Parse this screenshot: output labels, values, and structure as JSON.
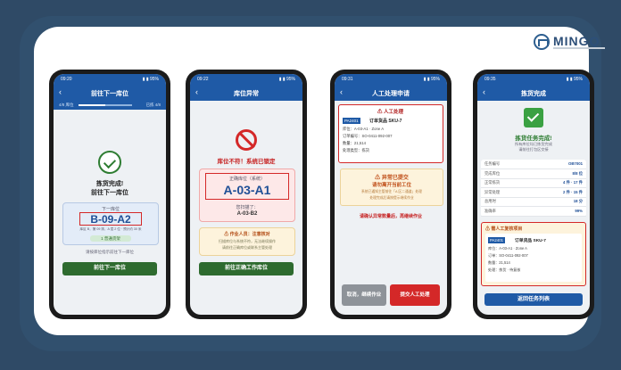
{
  "brand": {
    "name": "MINGQ"
  },
  "phone1": {
    "status_time": "09:20",
    "status_signal": "▮ ▮ 95%",
    "title": "前往下一库位",
    "progress_left": "4/8 库位",
    "progress_right": "已拣 4/8",
    "done_line1": "拣货完成!",
    "done_line2": "前往下一库位",
    "next_label": "下一库位",
    "location": "B-09-A2",
    "hint": "库区 B，第 09 排，A 层 2 位 · 预计约 30 米",
    "tag": "1 普通货架",
    "note": "请按库位指示前往下一库位",
    "button": "前往下一库位"
  },
  "phone2": {
    "status_time": "09:22",
    "status_signal": "▮ ▮ 95%",
    "title": "库位异常",
    "error_line": "库位不符！系统已锁定",
    "expected_label": "正确库位（系统）",
    "location": "A-03-A1",
    "scanned_label": "您扫描了：",
    "scanned_value": "A-03-B2",
    "warn_title": "⚠ 作业人员：注意核对",
    "warn_line1": "扫描库位与系统不符，无法继续操作",
    "warn_line2": "请前往正确库位或联系主管处理",
    "button": "前往正确工作库位"
  },
  "phone3": {
    "status_time": "09:31",
    "status_signal": "▮ ▮ 95%",
    "title": "人工处理申请",
    "card_header": "⚠ 人工处理",
    "sku_badge": "PA2401",
    "sku_name": "订单货品 SKU-7",
    "line1": "库位：A-03-A1 · Zone A",
    "line2": "订单编号：SO-0411-092-007",
    "line3": "数量：21,514",
    "line4": "处理类型：拣货",
    "alert_title": "⚠ 异常已提交",
    "alert_sub": "请勿离开当前工位",
    "alert_line1": "系统已通知主管前往「A 区二通道」处理",
    "alert_line2": "处理完成后请按提示继续作业",
    "red_note": "请确认异常数量后，再继续作业",
    "btn_left": "取消，继续作业",
    "btn_right": "提交人工处理"
  },
  "phone4": {
    "status_time": "09:35",
    "status_signal": "▮ ▮ 95%",
    "title": "拣货完成",
    "done_title": "拣货任务完成!",
    "done_sub1": "所有库位均已拣货完成",
    "done_sub2": "请前往打包区交接",
    "stats": [
      {
        "label": "任务编号",
        "value": "OB7001"
      },
      {
        "label": "完成库位",
        "value": "8/8 位"
      },
      {
        "label": "正常拣货",
        "value": "4 件 · 17 件"
      },
      {
        "label": "异常处理",
        "value": "2 件 · 15 件"
      },
      {
        "label": "总用时",
        "value": "18 分"
      },
      {
        "label": "准确率",
        "value": "99%"
      }
    ],
    "mini_header": "⚠ 需人工复核项目",
    "mini_badge": "PA2401",
    "mini_name": "订单货品 SKU-7",
    "mini_line1": "库位：A-03-A1 · Zone A",
    "mini_line2": "订单：SO-0411-092-007",
    "mini_line3": "数量：21,514",
    "mini_line4": "处理：拣货 · 待复核",
    "button": "返回任务列表"
  }
}
